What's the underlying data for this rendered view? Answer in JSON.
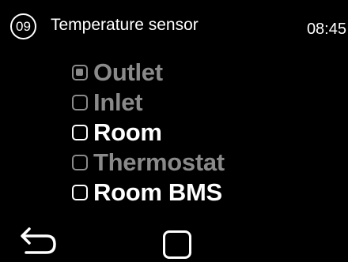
{
  "header": {
    "screen_number": "09",
    "title": "Temperature sensor",
    "time": "08:45"
  },
  "options": [
    {
      "label": "Outlet",
      "state": "disabled",
      "selected": true
    },
    {
      "label": "Inlet",
      "state": "disabled",
      "selected": false
    },
    {
      "label": "Room",
      "state": "enabled",
      "selected": false
    },
    {
      "label": "Thermostat",
      "state": "disabled",
      "selected": false
    },
    {
      "label": "Room BMS",
      "state": "enabled",
      "selected": false
    }
  ],
  "footer": {
    "back_icon": "back-arrow-icon",
    "home_icon": "square-icon"
  },
  "colors": {
    "background": "#000000",
    "text": "#ffffff",
    "disabled": "#8a8a8a"
  }
}
